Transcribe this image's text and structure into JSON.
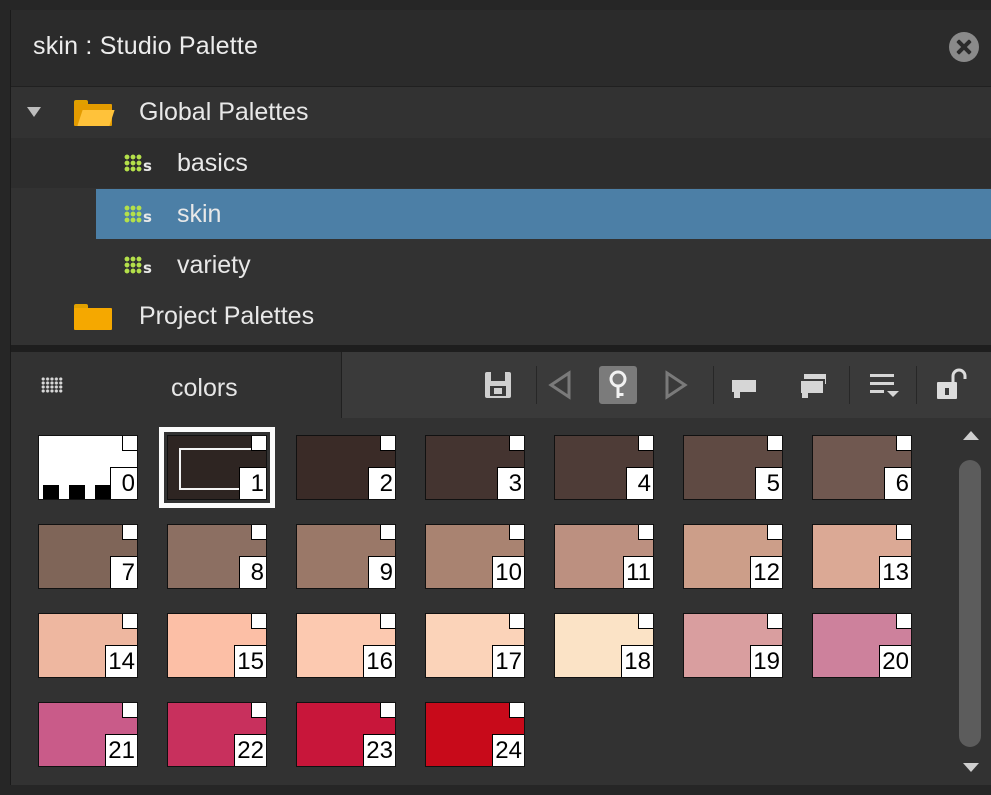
{
  "window": {
    "title": "skin : Studio Palette"
  },
  "tree": {
    "items": [
      {
        "label": "Global Palettes",
        "kind": "folder-open",
        "expanded": true
      },
      {
        "label": "basics",
        "kind": "palette"
      },
      {
        "label": "skin",
        "kind": "palette",
        "selected": true
      },
      {
        "label": "variety",
        "kind": "palette"
      },
      {
        "label": "Project Palettes",
        "kind": "folder"
      }
    ]
  },
  "toolbar": {
    "view_label": "colors",
    "icons": [
      "grid-view-icon",
      "save-icon",
      "prev-icon",
      "key-icon",
      "next-icon",
      "paste-style-icon",
      "new-style-icon",
      "menu-icon",
      "lock-icon"
    ]
  },
  "swatches": [
    {
      "id": "0",
      "color": "#ffffff"
    },
    {
      "id": "1",
      "color": "#2e2522",
      "selected": true
    },
    {
      "id": "2",
      "color": "#3a2b27"
    },
    {
      "id": "3",
      "color": "#443430"
    },
    {
      "id": "4",
      "color": "#4e3c37"
    },
    {
      "id": "5",
      "color": "#5f4a43"
    },
    {
      "id": "6",
      "color": "#705850"
    },
    {
      "id": "7",
      "color": "#7f6558"
    },
    {
      "id": "8",
      "color": "#8c6f62"
    },
    {
      "id": "9",
      "color": "#9a7868"
    },
    {
      "id": "10",
      "color": "#a98371"
    },
    {
      "id": "11",
      "color": "#bc9080"
    },
    {
      "id": "12",
      "color": "#cc9e89"
    },
    {
      "id": "13",
      "color": "#dba995"
    },
    {
      "id": "14",
      "color": "#eeb7a0"
    },
    {
      "id": "15",
      "color": "#fcbfa6"
    },
    {
      "id": "16",
      "color": "#fcc9b0"
    },
    {
      "id": "17",
      "color": "#fbd3b9"
    },
    {
      "id": "18",
      "color": "#fbe3c6"
    },
    {
      "id": "19",
      "color": "#d99e9f"
    },
    {
      "id": "20",
      "color": "#cd819c"
    },
    {
      "id": "21",
      "color": "#c95b89"
    },
    {
      "id": "22",
      "color": "#c8305d"
    },
    {
      "id": "23",
      "color": "#c8163a"
    },
    {
      "id": "24",
      "color": "#c80a1a"
    }
  ]
}
